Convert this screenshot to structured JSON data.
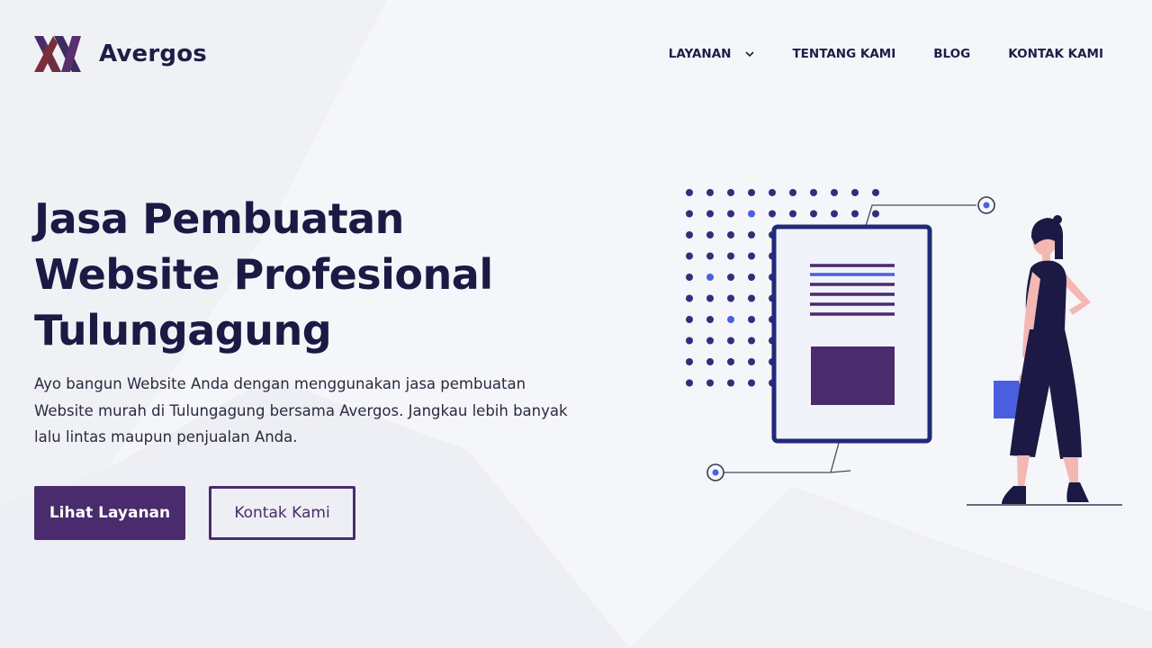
{
  "brand": {
    "name": "Avergos",
    "logo_icon": "avergos-logo-icon",
    "colors": {
      "primary": "#4a2b6d",
      "navy": "#1f1d47",
      "accent_blue": "#4a5fe0",
      "skin": "#f4b8b4"
    }
  },
  "nav": {
    "items": [
      {
        "label": "LAYANAN",
        "icon": "chevron-down-icon"
      },
      {
        "label": "TENTANG KAMI"
      },
      {
        "label": "BLOG"
      },
      {
        "label": "KONTAK KAMI"
      }
    ]
  },
  "hero": {
    "title_lines": [
      "Jasa Pembuatan",
      "Website Profesional",
      "Tulungagung"
    ],
    "description_lines": [
      "Ayo bangun Website Anda dengan menggunakan jasa pembuatan",
      "Website murah di Tulungagung bersama Avergos. Jangkau lebih banyak",
      "lalu lintas maupun penjualan Anda."
    ],
    "primary_button": "Lihat Layanan",
    "secondary_button": "Kontak Kami"
  },
  "illustration": {
    "icon": "woman-with-document-illustration"
  }
}
